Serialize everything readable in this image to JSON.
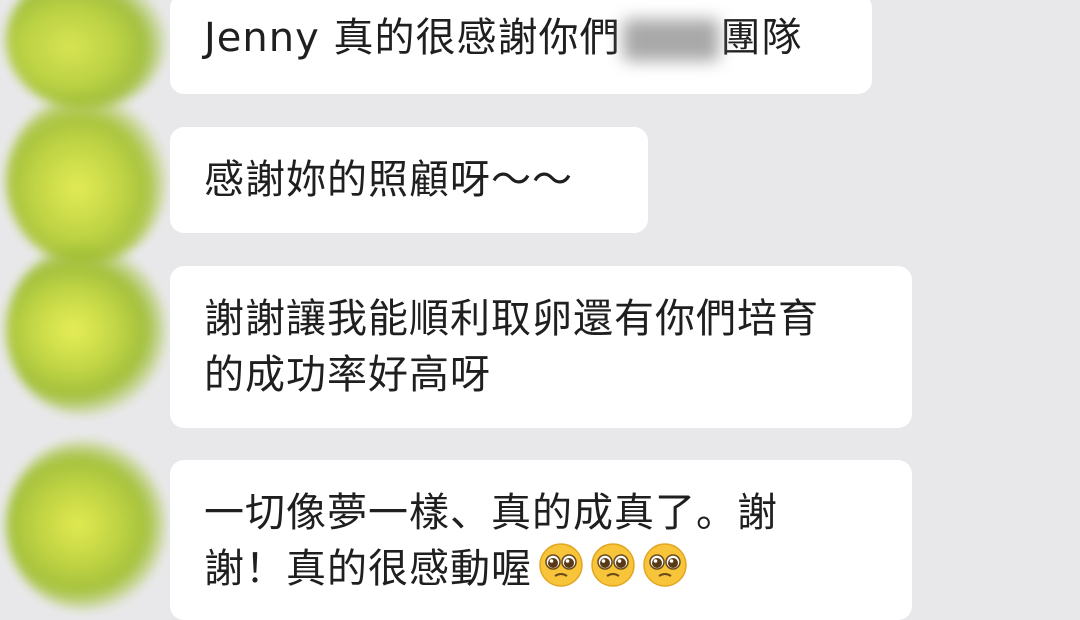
{
  "messages": [
    {
      "text_before": "Jenny 真的很感謝你們",
      "redacted": true,
      "text_after": "團隊"
    },
    {
      "text": "感謝妳的照顧呀～～"
    },
    {
      "line1": "謝謝讓我能順利取卵還有你們培育",
      "line2": "的成功率好高呀"
    },
    {
      "line1": "一切像夢一樣、真的成真了。謝",
      "line2": "謝！真的很感動喔",
      "emojis": [
        "pleading-face-icon",
        "pleading-face-icon",
        "pleading-face-icon"
      ]
    }
  ],
  "colors": {
    "background": "#e8e8ea",
    "bubble": "#ffffff",
    "text": "#1f1f1f",
    "avatar": "#c4d83f"
  }
}
